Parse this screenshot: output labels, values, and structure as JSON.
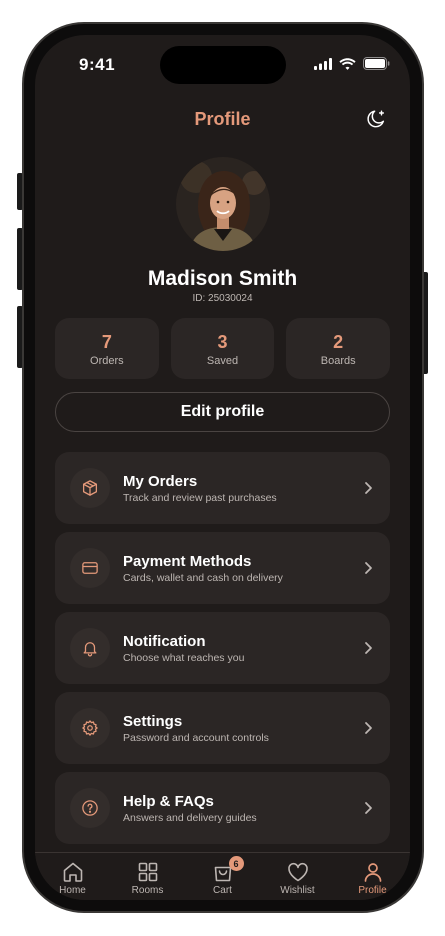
{
  "status_bar": {
    "time": "9:41"
  },
  "header": {
    "title": "Profile",
    "theme_icon": "moon-sparkle-icon"
  },
  "user": {
    "name": "Madison Smith",
    "id_text": "ID: 25030024"
  },
  "stats": [
    {
      "value": "7",
      "label": "Orders"
    },
    {
      "value": "3",
      "label": "Saved"
    },
    {
      "value": "2",
      "label": "Boards"
    }
  ],
  "edit_profile_label": "Edit profile",
  "menu": [
    {
      "title": "My Orders",
      "subtitle": "Track and review past purchases",
      "icon": "box-icon"
    },
    {
      "title": "Payment Methods",
      "subtitle": "Cards, wallet and cash on delivery",
      "icon": "credit-card-icon"
    },
    {
      "title": "Notification",
      "subtitle": "Choose what reaches you",
      "icon": "bell-icon"
    },
    {
      "title": "Settings",
      "subtitle": "Password and account controls",
      "icon": "gear-icon"
    },
    {
      "title": "Help & FAQs",
      "subtitle": "Answers and delivery guides",
      "icon": "question-icon"
    }
  ],
  "nav": [
    {
      "label": "Home",
      "icon": "home-icon"
    },
    {
      "label": "Rooms",
      "icon": "grid-icon"
    },
    {
      "label": "Cart",
      "icon": "cart-icon",
      "badge": "6"
    },
    {
      "label": "Wishlist",
      "icon": "heart-icon"
    },
    {
      "label": "Profile",
      "icon": "user-icon",
      "active": true
    }
  ],
  "colors": {
    "accent": "#e4997a",
    "background": "#1f1b1a",
    "card": "#2b2625"
  }
}
